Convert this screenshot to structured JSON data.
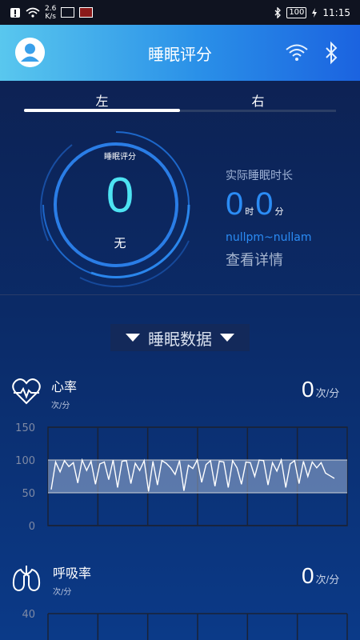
{
  "status_bar": {
    "net_speed_value": "2.6",
    "net_speed_unit": "K/s",
    "battery": "100",
    "time": "11:15"
  },
  "header": {
    "title": "睡眠评分",
    "icons": [
      "avatar-icon",
      "wifi-icon",
      "bluetooth-icon"
    ]
  },
  "tabs": {
    "left": "左",
    "right": "右",
    "active": "left"
  },
  "score": {
    "label": "睡眠评分",
    "value": "0",
    "grade": "无"
  },
  "duration": {
    "label": "实际睡眠时长",
    "hours": "0",
    "hours_unit": "时",
    "minutes": "0",
    "minutes_unit": "分",
    "range": "nullpm~nullam",
    "detail_link": "查看详情"
  },
  "section": {
    "title": "睡眠数据"
  },
  "heart_rate": {
    "name": "心率",
    "unit_small": "次/分",
    "value": "0",
    "unit": "次/分"
  },
  "respiration": {
    "name": "呼吸率",
    "unit_small": "次/分",
    "value": "0",
    "unit": "次/分"
  },
  "chart_data": [
    {
      "type": "line",
      "title": "",
      "y_ticks": [
        "150",
        "100",
        "50",
        "0"
      ],
      "ylim": [
        0,
        150
      ],
      "normal_band": [
        50,
        100
      ],
      "grid": true,
      "series": [
        {
          "values": [
            55,
            97,
            82,
            99,
            90,
            96,
            65,
            100,
            84,
            98,
            63,
            94,
            97,
            70,
            100,
            58,
            98,
            99,
            64,
            95,
            84,
            99,
            52,
            98,
            62,
            99,
            95,
            88,
            78,
            99,
            53,
            92,
            87,
            100,
            66,
            93,
            99,
            60,
            98,
            97,
            58,
            99,
            88,
            63,
            97,
            96,
            75,
            100,
            99,
            62,
            96,
            83,
            100,
            58,
            94,
            99,
            64,
            98,
            75,
            97,
            88,
            96,
            80,
            76,
            72
          ]
        }
      ],
      "line_color": "#ffffff",
      "band_color": "#9fb3d6"
    },
    {
      "type": "line",
      "title": "",
      "y_ticks": [
        "40"
      ],
      "grid": true,
      "series": []
    }
  ]
}
